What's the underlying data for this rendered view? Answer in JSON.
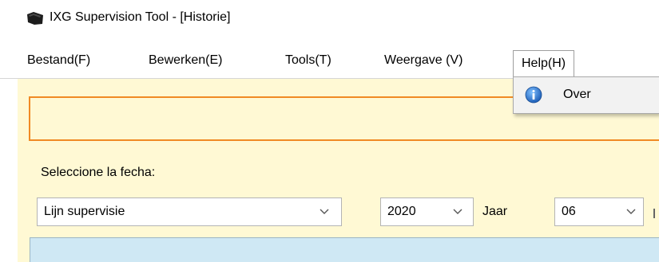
{
  "window": {
    "title": "IXG Supervision Tool - [Historie]",
    "app_icon": "tool-window-icon"
  },
  "menu": {
    "items": [
      "Bestand(F)",
      "Bewerken(E)",
      "Tools(T)",
      "Weergave (V)",
      "Help(H)"
    ],
    "active": "Help(H)"
  },
  "help_menu": {
    "items": [
      {
        "label": "Over",
        "icon": "info-icon"
      }
    ]
  },
  "form": {
    "date_label": "Seleccione la fecha:",
    "view_select": "Lijn supervisie",
    "year_select": "2020",
    "year_label": "Jaar",
    "month_select": "06"
  },
  "colors": {
    "content_bg": "#fff9d4",
    "accent_orange": "#f08a24",
    "panel_blue": "#cfe8f4",
    "info_blue": "#2b7fd4"
  }
}
